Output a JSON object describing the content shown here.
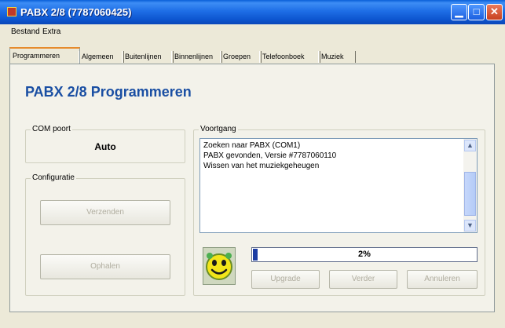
{
  "window": {
    "title": "PABX 2/8 (7787060425)"
  },
  "menu": {
    "items": [
      {
        "label": "Bestand"
      },
      {
        "label": "Extra"
      }
    ]
  },
  "tabs": [
    {
      "label": "Programmeren",
      "active": true
    },
    {
      "label": "Algemeen"
    },
    {
      "label": "Buitenlijnen"
    },
    {
      "label": "Binnenlijnen"
    },
    {
      "label": "Groepen"
    },
    {
      "label": "Telefoonboek"
    },
    {
      "label": "Muziek"
    }
  ],
  "page": {
    "title": "PABX 2/8 Programmeren"
  },
  "com_port": {
    "label": "COM poort",
    "value": "Auto"
  },
  "configuratie": {
    "label": "Configuratie",
    "send_label": "Verzenden",
    "fetch_label": "Ophalen"
  },
  "voortgang": {
    "label": "Voortgang",
    "log": [
      "Zoeken naar PABX (COM1)",
      "PABX gevonden, Versie #7787060110",
      "Wissen van het muziekgeheugen"
    ],
    "progress_text": "2%",
    "progress_value": 0.02,
    "upgrade_label": "Upgrade",
    "verder_label": "Verder",
    "annuleren_label": "Annuleren"
  },
  "colors": {
    "title_bar": "#0a5fd8",
    "heading": "#1a4fa3",
    "progress_fill": "#1c3da3",
    "active_tab_accent": "#e68b2c"
  }
}
